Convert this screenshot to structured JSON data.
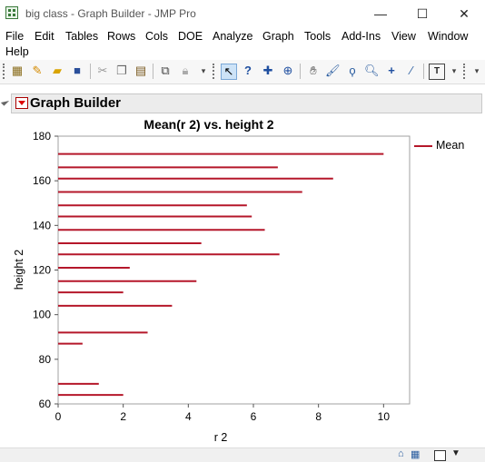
{
  "window": {
    "title": "big class - Graph Builder - JMP Pro"
  },
  "menu": [
    "File",
    "Edit",
    "Tables",
    "Rows",
    "Cols",
    "DOE",
    "Analyze",
    "Graph",
    "Tools",
    "Add-Ins",
    "View",
    "Window",
    "Help"
  ],
  "report": {
    "title": "Graph Builder"
  },
  "colors": {
    "bar": "#b5172a",
    "header_bg": "#ececec"
  },
  "chart_data": {
    "type": "bar",
    "orientation": "horizontal",
    "title": "Mean(r 2) vs. height 2",
    "xlabel": "r 2",
    "ylabel": "height 2",
    "xlim": [
      0,
      10.8
    ],
    "ylim": [
      60,
      180
    ],
    "xticks": [
      0,
      2,
      4,
      6,
      8,
      10
    ],
    "yticks": [
      60,
      80,
      100,
      120,
      140,
      160,
      180
    ],
    "legend": "right",
    "series": [
      {
        "name": "Mean",
        "points": [
          {
            "y": 172,
            "x": 10.0
          },
          {
            "y": 166,
            "x": 6.75
          },
          {
            "y": 161,
            "x": 8.45
          },
          {
            "y": 155,
            "x": 7.5
          },
          {
            "y": 149,
            "x": 5.8
          },
          {
            "y": 144,
            "x": 5.95
          },
          {
            "y": 138,
            "x": 6.35
          },
          {
            "y": 132,
            "x": 4.4
          },
          {
            "y": 127,
            "x": 6.8
          },
          {
            "y": 121,
            "x": 2.2
          },
          {
            "y": 115,
            "x": 4.25
          },
          {
            "y": 110,
            "x": 2.0
          },
          {
            "y": 104,
            "x": 3.5
          },
          {
            "y": 92,
            "x": 2.75
          },
          {
            "y": 87,
            "x": 0.75
          },
          {
            "y": 69,
            "x": 1.25
          },
          {
            "y": 64,
            "x": 2.0
          }
        ]
      }
    ]
  }
}
